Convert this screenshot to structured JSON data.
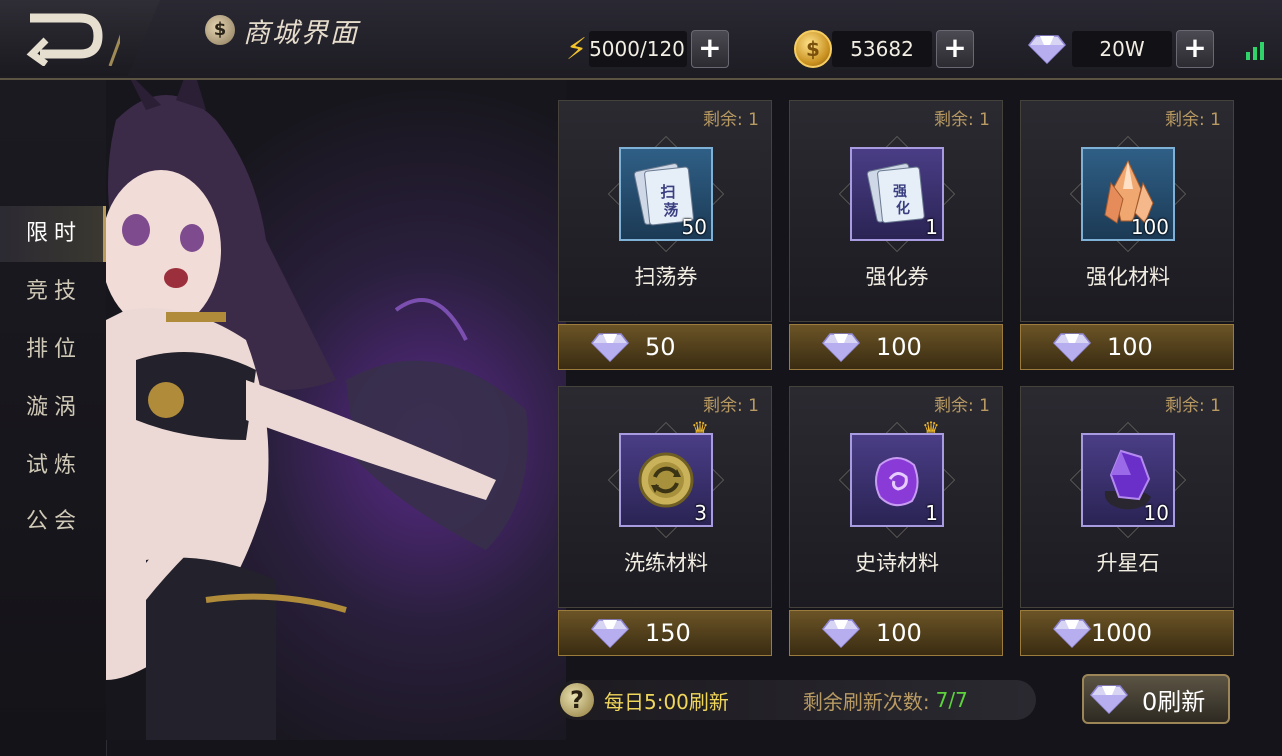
{
  "header": {
    "title": "商城界面",
    "energy": "5000/120",
    "gold": "53682",
    "diamonds": "20W"
  },
  "sidebar": {
    "items": [
      {
        "label": "限时",
        "active": true
      },
      {
        "label": "竞技",
        "active": false
      },
      {
        "label": "排位",
        "active": false
      },
      {
        "label": "漩涡",
        "active": false
      },
      {
        "label": "试炼",
        "active": false
      },
      {
        "label": "公会",
        "active": false
      }
    ]
  },
  "shop": {
    "items": [
      {
        "remain": "剩余: 1",
        "name": "扫荡券",
        "qty": "50",
        "price": "50",
        "icon": "sweep-ticket-icon"
      },
      {
        "remain": "剩余: 1",
        "name": "强化券",
        "qty": "1",
        "price": "100",
        "icon": "enhance-ticket-icon"
      },
      {
        "remain": "剩余: 1",
        "name": "强化材料",
        "qty": "100",
        "price": "100",
        "icon": "crystal-icon"
      },
      {
        "remain": "剩余: 1",
        "name": "洗练材料",
        "qty": "3",
        "price": "150",
        "icon": "refine-coin-icon"
      },
      {
        "remain": "剩余: 1",
        "name": "史诗材料",
        "qty": "1",
        "price": "100",
        "icon": "epic-stone-icon"
      },
      {
        "remain": "剩余: 1",
        "name": "升星石",
        "qty": "10",
        "price": "1000",
        "icon": "star-stone-icon"
      }
    ]
  },
  "footer": {
    "daily_refresh": "每日5:00刷新",
    "remain_label": "剩余刷新次数:",
    "remain_count": "7/7",
    "refresh_label": "0刷新"
  },
  "colors": {
    "gold_accent": "#b99a58",
    "price_bar": "#6b5426",
    "green": "#5dd33c"
  }
}
